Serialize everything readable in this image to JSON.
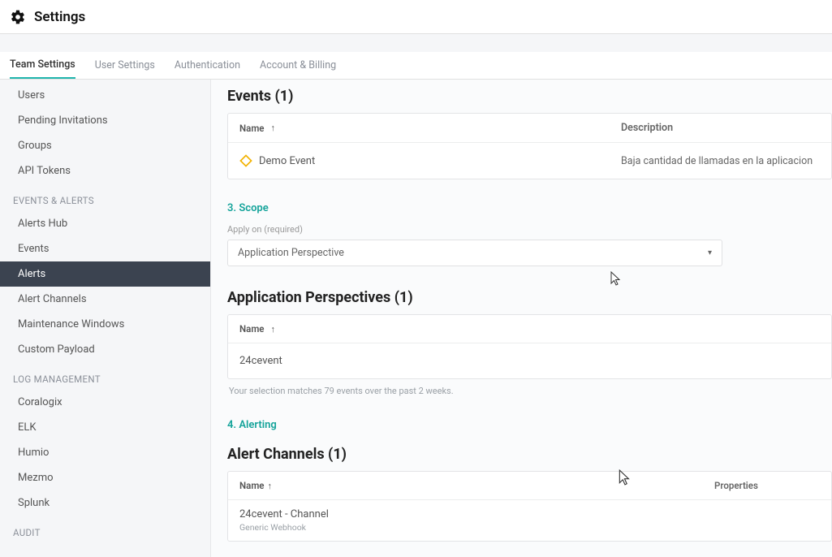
{
  "header": {
    "title": "Settings"
  },
  "tabs": {
    "items": [
      {
        "label": "Team Settings",
        "active": true
      },
      {
        "label": "User Settings"
      },
      {
        "label": "Authentication"
      },
      {
        "label": "Account & Billing"
      }
    ]
  },
  "sidebar": {
    "users": "Users",
    "pending": "Pending Invitations",
    "groups": "Groups",
    "api_tokens": "API Tokens",
    "group_events": "EVENTS & ALERTS",
    "alerts_hub": "Alerts Hub",
    "events": "Events",
    "alerts": "Alerts",
    "alert_channels": "Alert Channels",
    "maintenance": "Maintenance Windows",
    "custom_payload": "Custom Payload",
    "group_log": "LOG MANAGEMENT",
    "coralogix": "Coralogix",
    "elk": "ELK",
    "humio": "Humio",
    "mezmo": "Mezmo",
    "splunk": "Splunk",
    "group_audit": "AUDIT"
  },
  "events_section": {
    "title": "Events (1)",
    "name_col": "Name",
    "desc_col": "Description",
    "row_name": "Demo Event",
    "row_desc": "Baja cantidad de llamadas en la aplicacion"
  },
  "scope": {
    "step_label": "3. Scope",
    "apply_label": "Apply on (required)",
    "selected": "Application Perspective"
  },
  "app_perspectives": {
    "title": "Application Perspectives (1)",
    "name_col": "Name",
    "row_name": "24cevent",
    "hint": "Your selection matches 79 events over the past 2 weeks."
  },
  "alerting": {
    "step_label": "4. Alerting"
  },
  "alert_channels": {
    "title": "Alert Channels (1)",
    "name_col": "Name",
    "props_col": "Properties",
    "row_name": "24cevent - Channel",
    "row_sub": "Generic Webhook"
  }
}
